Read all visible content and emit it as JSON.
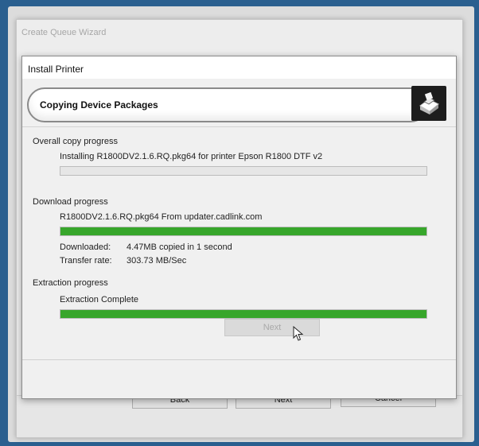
{
  "outer_window": {
    "title": "Create Queue Wizard",
    "buttons": {
      "back": "Back",
      "next": "Next",
      "cancel": "Cancel"
    }
  },
  "dialog": {
    "title": "Install Printer",
    "header": "Copying Device Packages",
    "header_icon": "printer-icon",
    "overall": {
      "label": "Overall copy progress",
      "status": "Installing R1800DV2.1.6.RQ.pkg64 for printer Epson R1800 DTF v2",
      "progress": 0.0
    },
    "download": {
      "label": "Download progress",
      "status": "R1800DV2.1.6.RQ.pkg64 From updater.cadlink.com",
      "progress": 1.0,
      "downloaded_label": "Downloaded:",
      "downloaded_value": "4.47MB copied in 1 second",
      "rate_label": "Transfer rate:",
      "rate_value": "303.73 MB/Sec"
    },
    "extraction": {
      "label": "Extraction progress",
      "status": "Extraction Complete",
      "progress": 1.0
    },
    "next_label": "Next"
  },
  "colors": {
    "progress_fill": "#37a62b",
    "desktop": "#2a5f8f"
  }
}
